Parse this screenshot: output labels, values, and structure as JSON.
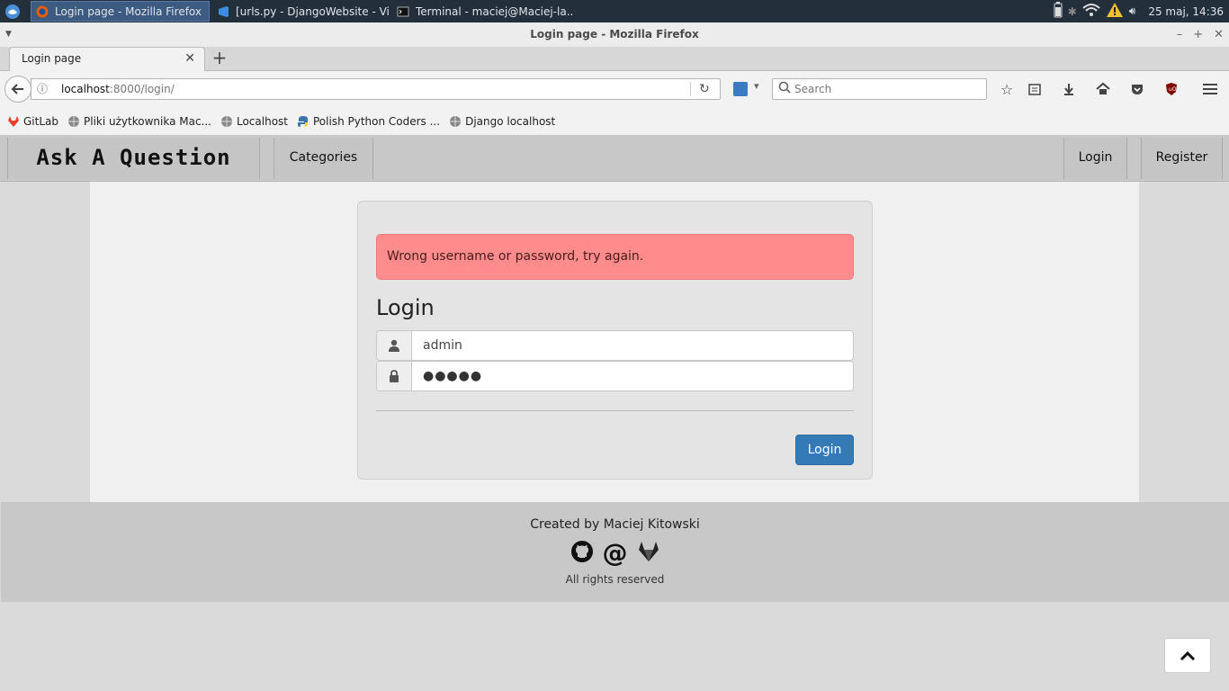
{
  "os_panel": {
    "tasks": [
      {
        "label": "Login page - Mozilla Firefox",
        "active": true
      },
      {
        "label": "[urls.py - DjangoWebsite - Vi...",
        "active": false
      },
      {
        "label": "Terminal - maciej@Maciej-la...",
        "active": false
      }
    ],
    "clock": "25 maj, 14:36"
  },
  "window": {
    "title": "Login page - Mozilla Firefox"
  },
  "browser": {
    "tab_title": "Login page",
    "url_host": "localhost",
    "url_rest": ":8000/login/",
    "search_placeholder": "Search",
    "bookmarks": [
      {
        "label": "GitLab",
        "icon": "gitlab-icon"
      },
      {
        "label": "Pliki użytkownika Mac...",
        "icon": "globe-icon"
      },
      {
        "label": "Localhost",
        "icon": "globe-icon"
      },
      {
        "label": "Polish Python Coders ...",
        "icon": "python-icon"
      },
      {
        "label": "Django localhost",
        "icon": "globe-icon"
      }
    ]
  },
  "site": {
    "brand": "Ask A Question",
    "nav": {
      "categories": "Categories",
      "login": "Login",
      "register": "Register"
    },
    "alert": "Wrong username or password, try again.",
    "form": {
      "heading": "Login",
      "username_value": "admin",
      "password_value": "●●●●●",
      "submit": "Login"
    },
    "footer": {
      "created": "Created by Maciej Kitowski",
      "rights": "All rights reserved",
      "icons": [
        "github-icon",
        "at-icon",
        "gitlab-icon"
      ]
    }
  },
  "colors": {
    "alert_bg": "#ff8c8c",
    "primary": "#337ab7",
    "panel": "#23303c"
  }
}
